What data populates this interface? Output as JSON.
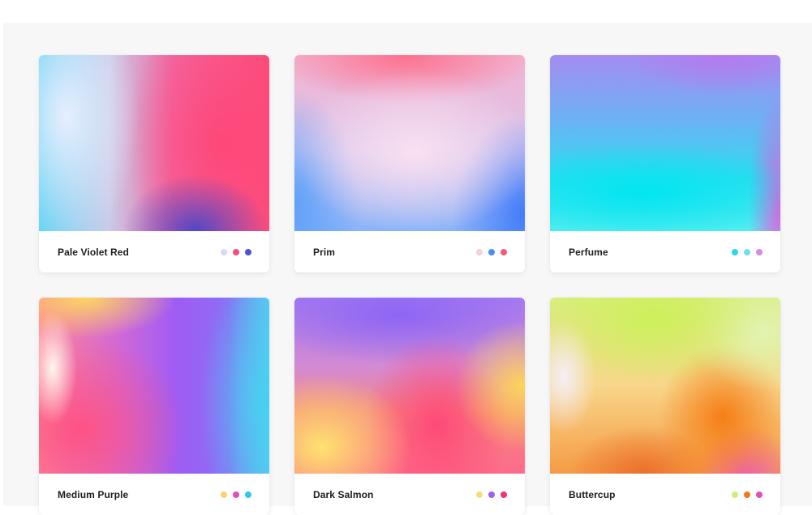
{
  "gradients": [
    {
      "name": "Pale Violet Red",
      "preview_style": "pale-violet-red",
      "swatches": [
        "#d5daf0",
        "#f24d7e",
        "#4a55cf"
      ]
    },
    {
      "name": "Prim",
      "preview_style": "prim",
      "swatches": [
        "#f7cde2",
        "#4a8ff0",
        "#f15b80"
      ]
    },
    {
      "name": "Perfume",
      "preview_style": "perfume",
      "swatches": [
        "#2ad9ea",
        "#6ee1ec",
        "#d78ae6"
      ]
    },
    {
      "name": "Medium Purple",
      "preview_style": "medium-purple",
      "swatches": [
        "#f7d56a",
        "#e54fb3",
        "#2dc9ec"
      ]
    },
    {
      "name": "Dark Salmon",
      "preview_style": "dark-salmon",
      "swatches": [
        "#f4de7c",
        "#9b63ee",
        "#f4336f"
      ]
    },
    {
      "name": "Buttercup",
      "preview_style": "buttercup",
      "swatches": [
        "#cdee7d",
        "#ed7a16",
        "#e54fb3"
      ]
    }
  ]
}
